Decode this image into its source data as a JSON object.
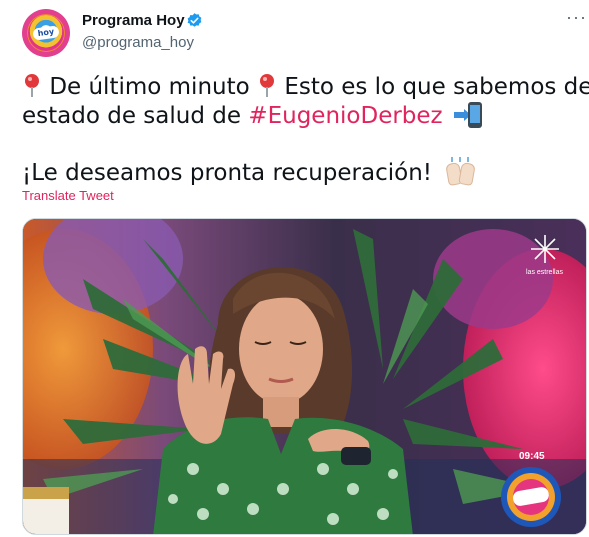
{
  "account": {
    "name": "Programa Hoy",
    "handle": "@programa_hoy",
    "verified": true,
    "avatar_logo": "hoy"
  },
  "menu_icon": "more-options-icon",
  "tweet": {
    "line1_a": "De último minuto",
    "line1_b": "Esto es lo que sabemos del",
    "line2_a": "estado de salud de",
    "hashtag": "#EugenioDerbez",
    "line3": "¡Le deseamos pronta recuperación!",
    "emoji": [
      "round-pushpin-icon",
      "mobile-arrow-icon",
      "raising-hands-icon"
    ]
  },
  "translate_label": "Translate Tweet",
  "media": {
    "watermark": "las estrellas",
    "timestamp": "09:45",
    "corner_logo": "hoy"
  },
  "colors": {
    "hashtag": "#e0245e",
    "verified": "#1d9bf0",
    "text": "#0f1419",
    "muted": "#536471"
  }
}
